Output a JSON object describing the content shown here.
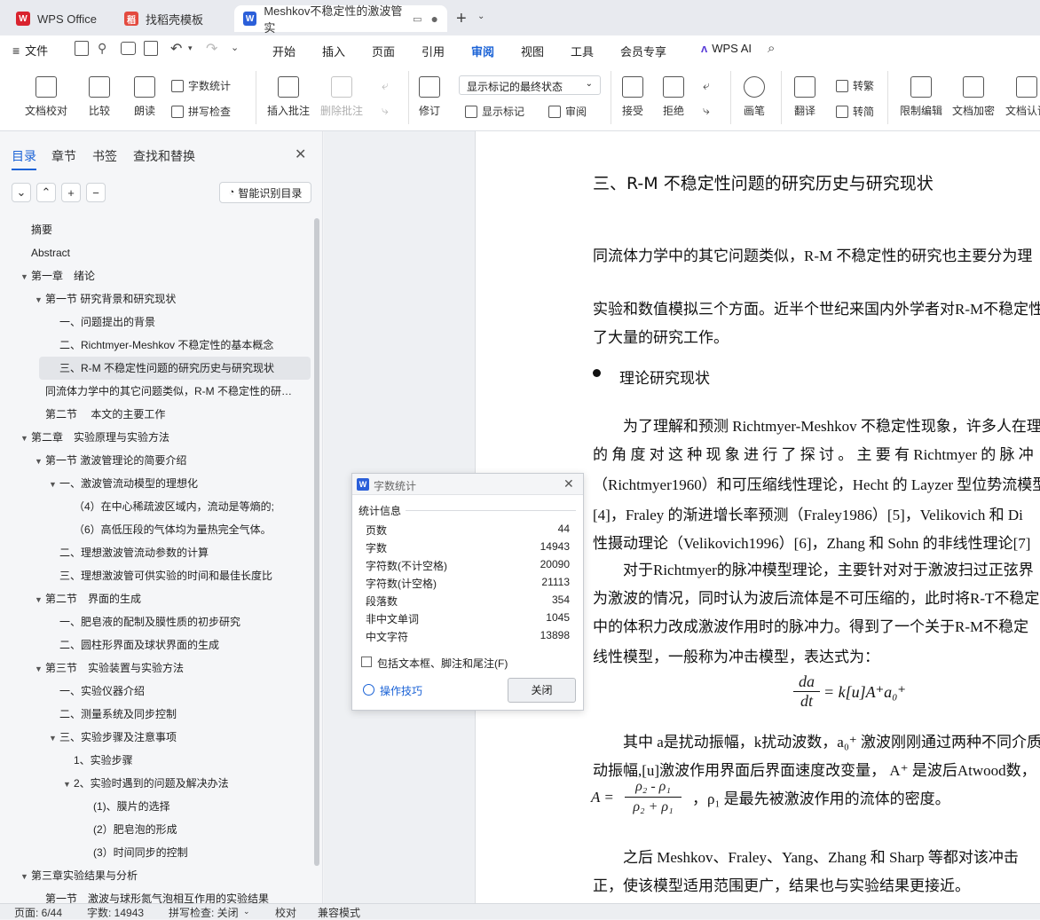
{
  "tabs": [
    {
      "label": "WPS Office",
      "icon": "wps-logo-icon",
      "color": "#d9232e"
    },
    {
      "label": "找稻壳模板",
      "icon": "docer-icon",
      "color": "#e34a3f"
    },
    {
      "label": "Meshkov不稳定性的激波管实",
      "icon": "word-doc-icon",
      "color": "#2b5fd9"
    }
  ],
  "menu": {
    "file": "文件",
    "items": [
      "开始",
      "插入",
      "页面",
      "引用",
      "审阅",
      "视图",
      "工具",
      "会员专享"
    ],
    "active": "审阅",
    "ai": "WPS AI"
  },
  "ribbon": {
    "doc_check": "文档校对",
    "compare": "比较",
    "read_aloud": "朗读",
    "word_count": "字数统计",
    "spell_check": "拼写检查",
    "insert_comment": "插入批注",
    "delete_comment": "删除批注",
    "track_changes": "修订",
    "markup_state": "显示标记的最终状态",
    "show_markup": "显示标记",
    "review_pane": "审阅",
    "accept": "接受",
    "reject": "拒绝",
    "pen": "画笔",
    "translate": "翻译",
    "to_traditional": "转繁",
    "to_simplified": "转简",
    "restrict_edit": "限制编辑",
    "encrypt": "文档加密",
    "doc_auth": "文档认证"
  },
  "nav": {
    "tabs": [
      "目录",
      "章节",
      "书签",
      "查找和替换"
    ],
    "active_tab": "目录",
    "smart_toc": "智能识别目录",
    "items": [
      {
        "text": "摘要",
        "level": 0,
        "caret": ""
      },
      {
        "text": "Abstract",
        "level": 0,
        "caret": ""
      },
      {
        "text": "第一章　绪论",
        "level": 0,
        "caret": "▼"
      },
      {
        "text": "第一节  研究背景和研究现状",
        "level": 1,
        "caret": "▼"
      },
      {
        "text": "一、问题提出的背景",
        "level": 2,
        "caret": ""
      },
      {
        "text": "二、Richtmyer-Meshkov 不稳定性的基本概念",
        "level": 2,
        "caret": ""
      },
      {
        "text": "三、R-M 不稳定性问题的研究历史与研究现状",
        "level": 2,
        "caret": "",
        "selected": true
      },
      {
        "text": "同流体力学中的其它问题类似，R-M 不稳定性的研…",
        "level": 1,
        "caret": ""
      },
      {
        "text": "第二节　 本文的主要工作",
        "level": 1,
        "caret": ""
      },
      {
        "text": "第二章　实验原理与实验方法",
        "level": 0,
        "caret": "▼"
      },
      {
        "text": "第一节  激波管理论的简要介绍",
        "level": 1,
        "caret": "▼"
      },
      {
        "text": "一、激波管流动模型的理想化",
        "level": 2,
        "caret": "▼"
      },
      {
        "text": "（4）在中心稀疏波区域内，流动是等熵的;",
        "level": 3,
        "caret": ""
      },
      {
        "text": "（6）高低压段的气体均为量热完全气体。",
        "level": 3,
        "caret": ""
      },
      {
        "text": "二、理想激波管流动参数的计算",
        "level": 2,
        "caret": ""
      },
      {
        "text": "三、理想激波管可供实验的时间和最佳长度比",
        "level": 2,
        "caret": ""
      },
      {
        "text": "第二节　界面的生成",
        "level": 1,
        "caret": "▼"
      },
      {
        "text": "一、肥皂液的配制及膜性质的初步研究",
        "level": 2,
        "caret": ""
      },
      {
        "text": "二、圆柱形界面及球状界面的生成",
        "level": 2,
        "caret": ""
      },
      {
        "text": "第三节　实验装置与实验方法",
        "level": 1,
        "caret": "▼"
      },
      {
        "text": "一、实验仪器介绍",
        "level": 2,
        "caret": ""
      },
      {
        "text": "二、测量系统及同步控制",
        "level": 2,
        "caret": ""
      },
      {
        "text": "三、实验步骤及注意事项",
        "level": 2,
        "caret": "▼"
      },
      {
        "text": "1、实验步骤",
        "level": 3,
        "caret": ""
      },
      {
        "text": "2、实验时遇到的问题及解决办法",
        "level": 3,
        "caret": "▼"
      },
      {
        "text": "(1)、膜片的选择",
        "level": 4,
        "caret": ""
      },
      {
        "text": "(2）肥皂泡的形成",
        "level": 4,
        "caret": ""
      },
      {
        "text": "(3）时间同步的控制",
        "level": 4,
        "caret": ""
      },
      {
        "text": "第三章实验结果与分析",
        "level": 0,
        "caret": "▼"
      },
      {
        "text": "第一节　激波与球形氮气泡相互作用的实验结果",
        "level": 1,
        "caret": ""
      }
    ]
  },
  "document": {
    "heading": "三、R-M 不稳定性问题的研究历史与研究现状",
    "p1": "同流体力学中的其它问题类似，R-M 不稳定性的研究也主要分为理",
    "p2a": "实验和数值模拟三个方面。近半个世纪来国内外学者对R-M不稳定性",
    "p2b": "了大量的研究工作。",
    "bullet": "理论研究现状",
    "p3a": "为了理解和预测 Richtmyer-Meshkov 不稳定性现象，许多人在理",
    "p3b": "的 角 度 对 这 种 现 象 进 行 了 探 讨 。 主 要 有  Richtmyer  的 脉 冲",
    "p3c": "（Richtmyer1960）和可压缩线性理论，Hecht 的 Layzer 型位势流模型",
    "p3d": "[4]，Fraley 的渐进增长率预测（Fraley1986）[5]，Velikovich 和 Di",
    "p3e": "性摄动理论（Velikovich1996）[6]，Zhang 和 Sohn 的非线性理论[7]",
    "p4a": "对于Richtmyer的脉冲模型理论，主要针对对于激波扫过正弦界",
    "p4b": "为激波的情况，同时认为波后流体是不可压缩的，此时将R-T不稳定",
    "p4c": "中的体积力改成激波作用时的脉冲力。得到了一个关于R-M不稳定",
    "p4d": "线性模型，一般称为冲击模型，表达式为：",
    "eq_num": "da",
    "eq_den": "dt",
    "eq_rhs": "= k[u]A⁺a₀⁺",
    "p5a": "其中  a是扰动振幅，k扰动波数，a₀⁺ 激波刚刚通过两种不同介质",
    "p5b": "动振幅,[u]激波作用界面后界面速度改变量，  A⁺ 是波后Atwood数，",
    "eq2_lhs": "A =",
    "eq2_num": "ρ₂ - ρ₁",
    "eq2_den": "ρ₂ + ρ₁",
    "p5c": "，ρ₁  是最先被激波作用的流体的密度。",
    "p6a": "之后 Meshkov、Fraley、Yang、Zhang 和 Sharp 等都对该冲击",
    "p6b": "正，使该模型适用范围更广，结果也与实验结果更接近。"
  },
  "dialog": {
    "title": "字数统计",
    "group": "统计信息",
    "rows": [
      {
        "label": "页数",
        "value": "44"
      },
      {
        "label": "字数",
        "value": "14943"
      },
      {
        "label": "字符数(不计空格)",
        "value": "20090"
      },
      {
        "label": "字符数(计空格)",
        "value": "21113"
      },
      {
        "label": "段落数",
        "value": "354"
      },
      {
        "label": "非中文单词",
        "value": "1045"
      },
      {
        "label": "中文字符",
        "value": "13898"
      }
    ],
    "checkbox": "包括文本框、脚注和尾注(F)",
    "tips": "操作技巧",
    "close": "关闭"
  },
  "status": {
    "page": "页面: 6/44",
    "words": "字数: 14943",
    "spell": "拼写检查: 关闭",
    "proof": "校对",
    "compat": "兼容模式"
  },
  "colors": {
    "accent": "#1a62d6"
  }
}
